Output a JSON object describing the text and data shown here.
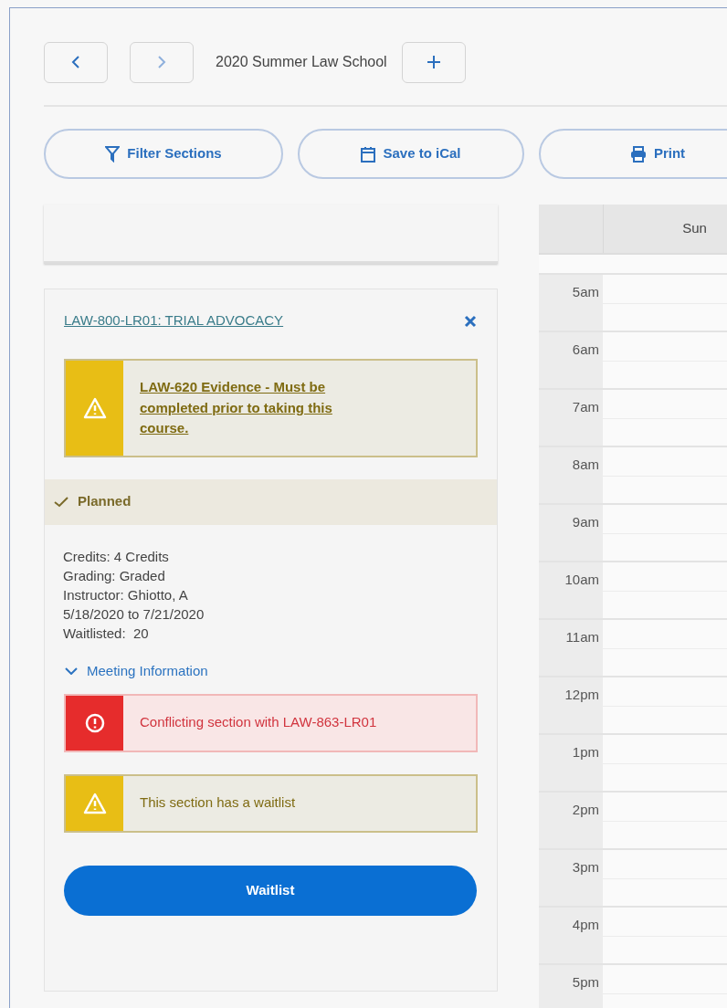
{
  "nav": {
    "title": "2020 Summer Law School"
  },
  "actions": [
    {
      "kind": "filter",
      "label": "Filter Sections"
    },
    {
      "kind": "calendar",
      "label": "Save to iCal"
    },
    {
      "kind": "print",
      "label": "Print"
    }
  ],
  "course": {
    "title": "LAW-800-LR01: TRIAL ADVOCACY",
    "alerts_top": [
      {
        "kind": "warning",
        "text": "LAW-620 Evidence - Must be completed prior to taking this course.",
        "link": true
      }
    ],
    "status": "Planned",
    "details": [
      "Credits: 4 Credits",
      "Grading: Graded",
      "Instructor: Ghiotto, A",
      "5/18/2020 to 7/21/2020",
      "Waitlisted:  20"
    ],
    "meeting_toggle": {
      "label": "Meeting Information",
      "expanded": false
    },
    "alerts": [
      {
        "kind": "error",
        "text": "Conflicting section with LAW-863-LR01",
        "link": false
      },
      {
        "kind": "warning",
        "text": "This section has a waitlist",
        "link": false
      }
    ],
    "button": "Waitlist"
  },
  "calendar": {
    "days": [
      "Sun"
    ],
    "hours": [
      "5am",
      "6am",
      "7am",
      "8am",
      "9am",
      "10am",
      "11am",
      "12pm",
      "1pm",
      "2pm",
      "3pm",
      "4pm",
      "5pm"
    ]
  }
}
